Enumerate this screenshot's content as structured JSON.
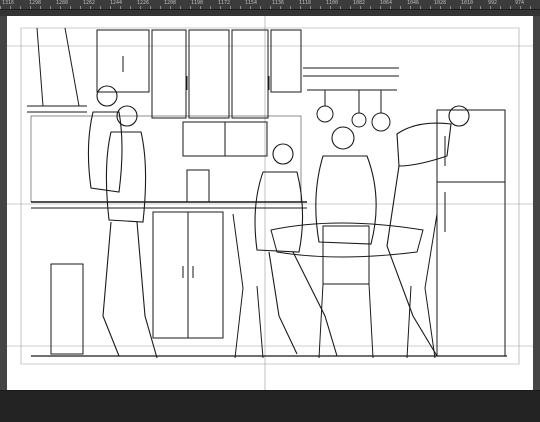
{
  "ruler": {
    "labels": [
      "1316",
      "1298",
      "1280",
      "1262",
      "1244",
      "1226",
      "1208",
      "1190",
      "1172",
      "1154",
      "1136",
      "1118",
      "1100",
      "1082",
      "1064",
      "1046",
      "1028",
      "1010",
      "992",
      "974"
    ]
  },
  "canvas": {
    "subject": "kitchen-scene-lineart",
    "colors": {
      "ink": "#1a1a1a",
      "guide": "#9a9a9a",
      "paper": "#ffffff",
      "workspace": "#454545"
    }
  }
}
